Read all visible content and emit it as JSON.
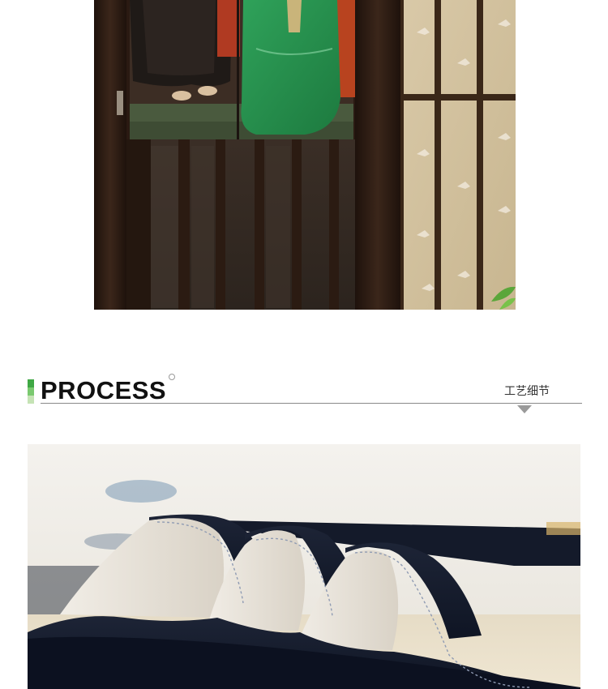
{
  "process_section": {
    "title": "PROCESS",
    "subtitle": "工艺细节"
  },
  "images": {
    "top_photo": "door-curtain-photo",
    "bottom_photo": "fabric-detail-photo"
  },
  "colors": {
    "accent_dark": "#3fa844",
    "accent_mid": "#7ac96f",
    "accent_light": "#c5e3b5",
    "divider": "#8a8a8a",
    "title_text": "#111111"
  }
}
